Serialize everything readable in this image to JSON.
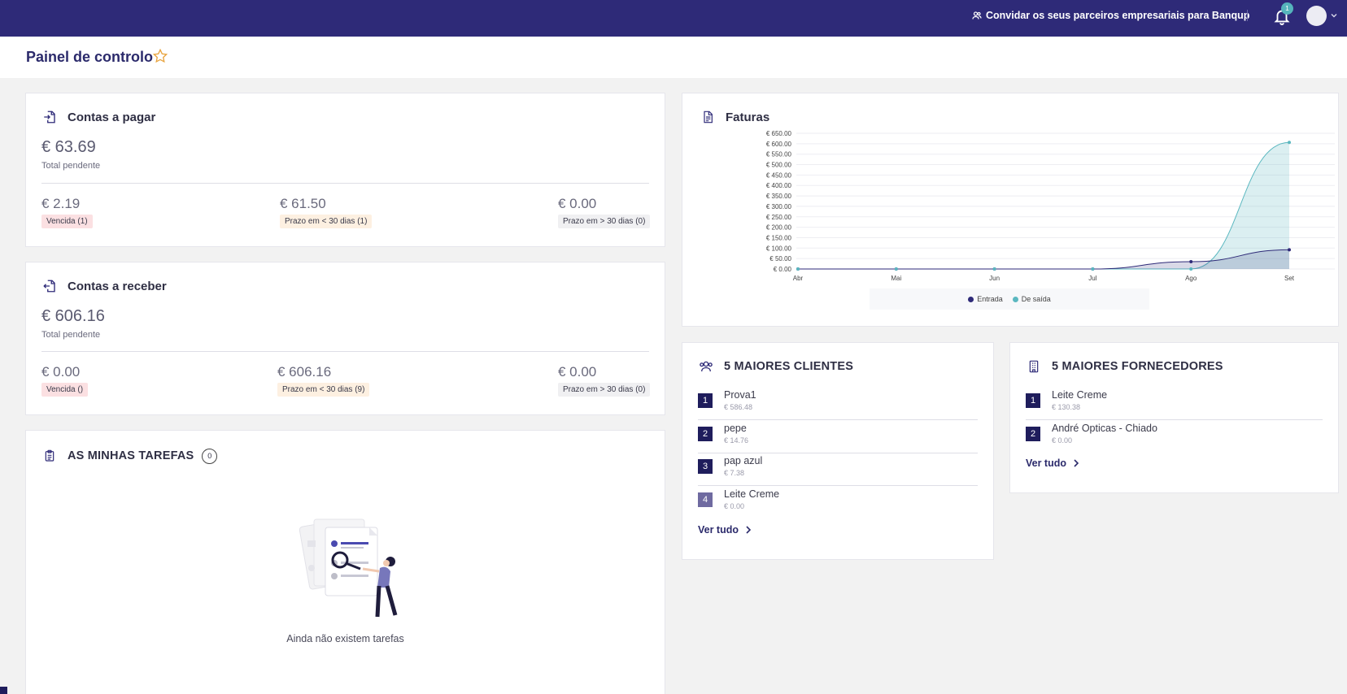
{
  "topbar": {
    "invite_label": "Convidar os seus parceiros empresariais para Banqup",
    "invite_icon": "users-icon",
    "notification_count": "1",
    "bell_icon": "bell-icon",
    "brand_color": "#2e2a78"
  },
  "page": {
    "title": "Painel de controlo",
    "favorite_icon": "star-icon",
    "accent_color": "#e8a33d"
  },
  "payables": {
    "title": "Contas a pagar",
    "icon": "file-import-icon",
    "total": "€ 63.69",
    "total_label": "Total pendente",
    "buckets": [
      {
        "amount": "€ 2.19",
        "label": "Vencida (1)",
        "status_color": "#fbe0e2"
      },
      {
        "amount": "€ 61.50",
        "label": "Prazo em < 30 dias (1)",
        "status_color": "#fdf0e1"
      },
      {
        "amount": "€ 0.00",
        "label": "Prazo em > 30 dias (0)",
        "status_color": "#f0f0f2"
      }
    ]
  },
  "receivables": {
    "title": "Contas a receber",
    "icon": "file-export-icon",
    "total": "€ 606.16",
    "total_label": "Total pendente",
    "buckets": [
      {
        "amount": "€ 0.00",
        "label": "Vencida ()",
        "status_color": "#fbe0e2"
      },
      {
        "amount": "€ 606.16",
        "label": "Prazo em < 30 dias (9)",
        "status_color": "#fdf0e1"
      },
      {
        "amount": "€ 0.00",
        "label": "Prazo em > 30 dias (0)",
        "status_color": "#f0f0f2"
      }
    ]
  },
  "tasks": {
    "title": "AS MINHAS TAREFAS",
    "icon": "clipboard-icon",
    "count": "0",
    "empty_message": "Ainda não existem tarefas",
    "illustration": "search-documents-illustration"
  },
  "invoices": {
    "title": "Faturas",
    "icon": "document-icon"
  },
  "chart_data": {
    "type": "area",
    "title": "Faturas",
    "categories": [
      "Abr",
      "Mai",
      "Jun",
      "Jul",
      "Ago",
      "Set"
    ],
    "y_ticks": [
      "€ 0.00",
      "€ 50.00",
      "€ 100.00",
      "€ 150.00",
      "€ 200.00",
      "€ 250.00",
      "€ 300.00",
      "€ 350.00",
      "€ 400.00",
      "€ 450.00",
      "€ 500.00",
      "€ 550.00",
      "€ 600.00",
      "€ 650.00"
    ],
    "ylim": [
      0,
      650
    ],
    "grid": true,
    "legend": "bottom",
    "series": [
      {
        "name": "Entrada",
        "color": "#2e2a78",
        "values": [
          0,
          0,
          0,
          0,
          35,
          92
        ]
      },
      {
        "name": "De saída",
        "color": "#5bb8c0",
        "values": [
          0,
          0,
          0,
          0,
          0,
          606.16
        ]
      }
    ]
  },
  "top_clients": {
    "title": "5 MAIORES CLIENTES",
    "icon": "users-icon",
    "items": [
      {
        "rank": "1",
        "name": "Prova1",
        "value": "€ 586.48"
      },
      {
        "rank": "2",
        "name": "pepe",
        "value": "€ 14.76"
      },
      {
        "rank": "3",
        "name": "pap azul",
        "value": "€ 7.38"
      },
      {
        "rank": "4",
        "name": "Leite Creme",
        "value": "€ 0.00"
      }
    ],
    "see_all": "Ver tudo"
  },
  "top_suppliers": {
    "title": "5 MAIORES FORNECEDORES",
    "icon": "building-icon",
    "items": [
      {
        "rank": "1",
        "name": "Leite Creme",
        "value": "€ 130.38"
      },
      {
        "rank": "2",
        "name": "André Opticas - Chiado",
        "value": "€ 0.00"
      }
    ],
    "see_all": "Ver tudo"
  }
}
